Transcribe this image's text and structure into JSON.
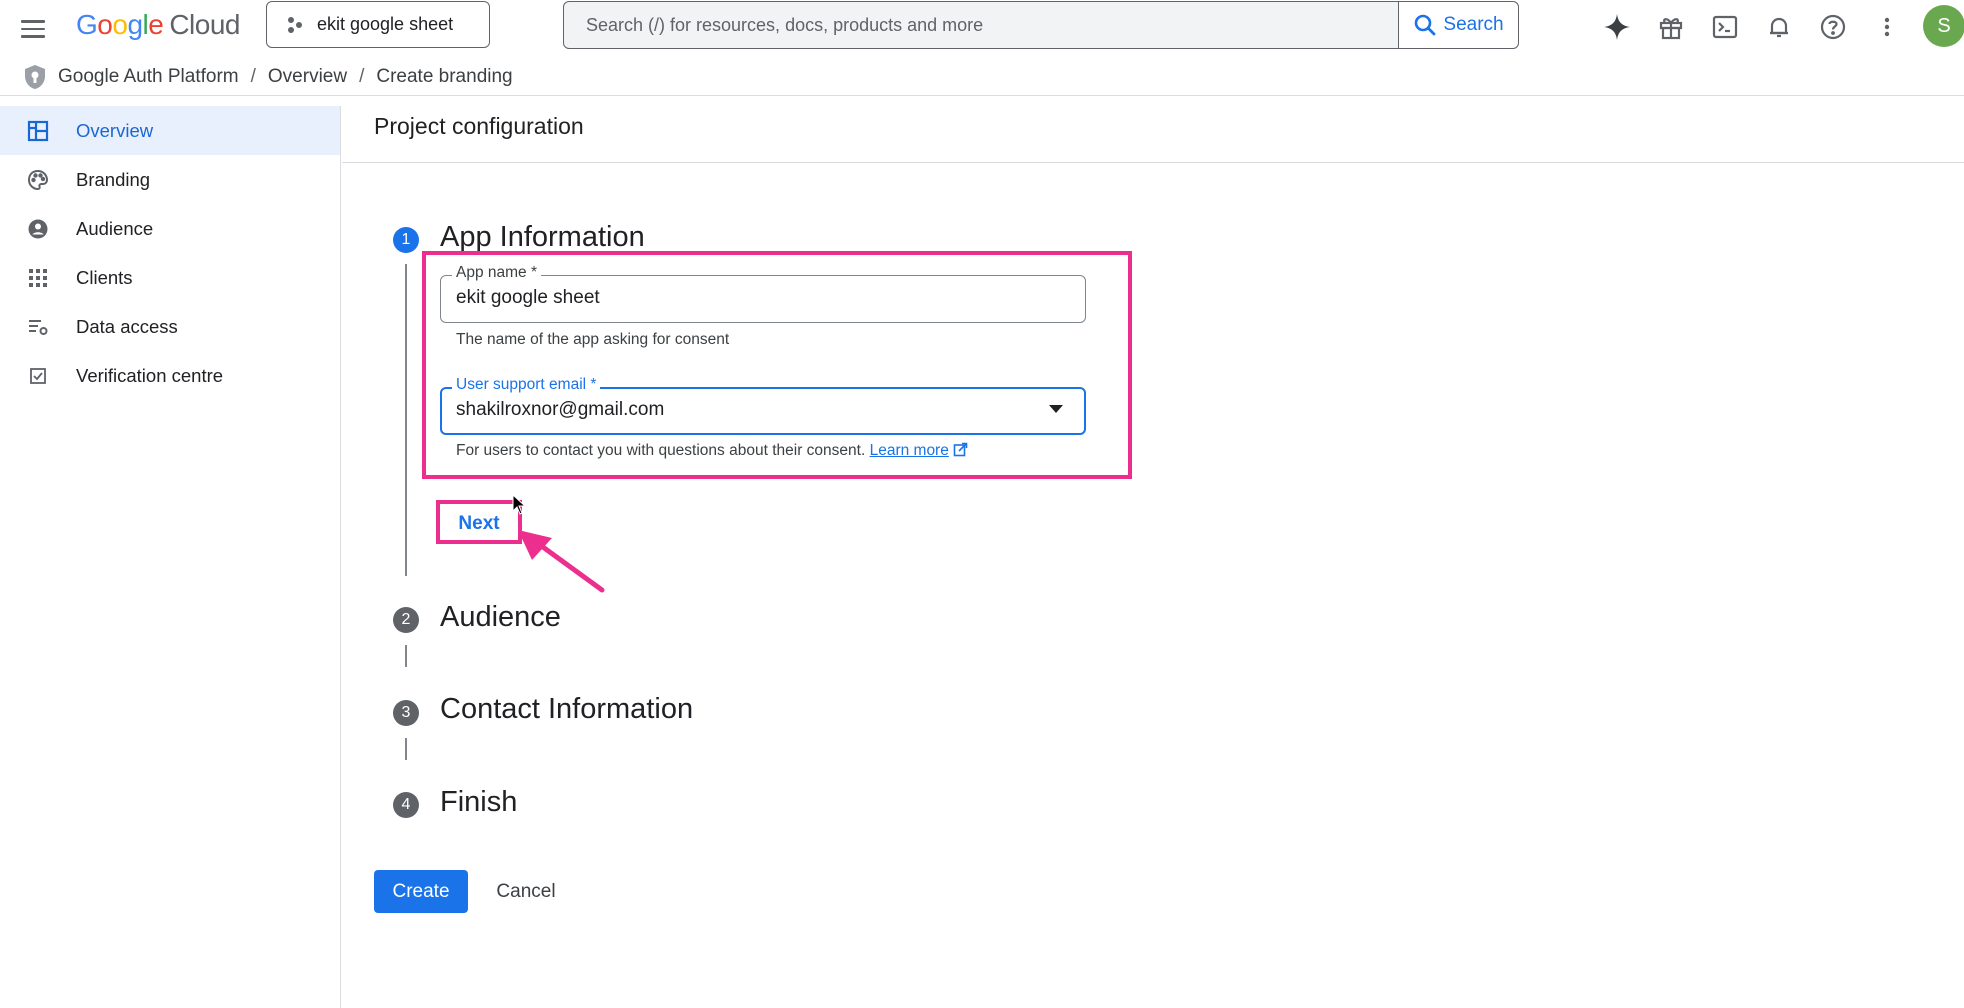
{
  "header": {
    "logo_google": [
      "G",
      "o",
      "o",
      "g",
      "l",
      "e"
    ],
    "logo_cloud": "Cloud",
    "project_name": "ekit google sheet",
    "search_placeholder": "Search (/) for resources, docs, products and more",
    "search_button": "Search",
    "icons": [
      "gemini-icon",
      "gift-icon",
      "terminal-icon",
      "bell-icon",
      "help-icon",
      "more-vert-icon"
    ],
    "avatar_letter": "S",
    "avatar_color": "#6aa84f"
  },
  "breadcrumb": [
    "Google Auth Platform",
    "Overview",
    "Create branding"
  ],
  "sidebar": {
    "items": [
      {
        "label": "Overview",
        "icon": "dashboard-icon",
        "active": true
      },
      {
        "label": "Branding",
        "icon": "palette-icon",
        "active": false
      },
      {
        "label": "Audience",
        "icon": "person-circle-icon",
        "active": false
      },
      {
        "label": "Clients",
        "icon": "grid-icon",
        "active": false
      },
      {
        "label": "Data access",
        "icon": "list-settings-icon",
        "active": false
      },
      {
        "label": "Verification centre",
        "icon": "checkbox-icon",
        "active": false
      }
    ]
  },
  "main": {
    "title": "Project configuration",
    "steps": [
      {
        "num": "1",
        "title": "App Information"
      },
      {
        "num": "2",
        "title": "Audience"
      },
      {
        "num": "3",
        "title": "Contact Information"
      },
      {
        "num": "4",
        "title": "Finish"
      }
    ],
    "app_name": {
      "label": "App name *",
      "value": "ekit google sheet",
      "helper": "The name of the app asking for consent"
    },
    "support_email": {
      "label": "User support email *",
      "value": "shakilroxnor@gmail.com",
      "helper": "For users to contact you with questions about their consent.",
      "link": "Learn more"
    },
    "next_label": "Next",
    "create_label": "Create",
    "cancel_label": "Cancel"
  },
  "colors": {
    "accent": "#1a73e8",
    "highlight": "#ec2e8e",
    "active_bg": "#e8f0fe"
  }
}
